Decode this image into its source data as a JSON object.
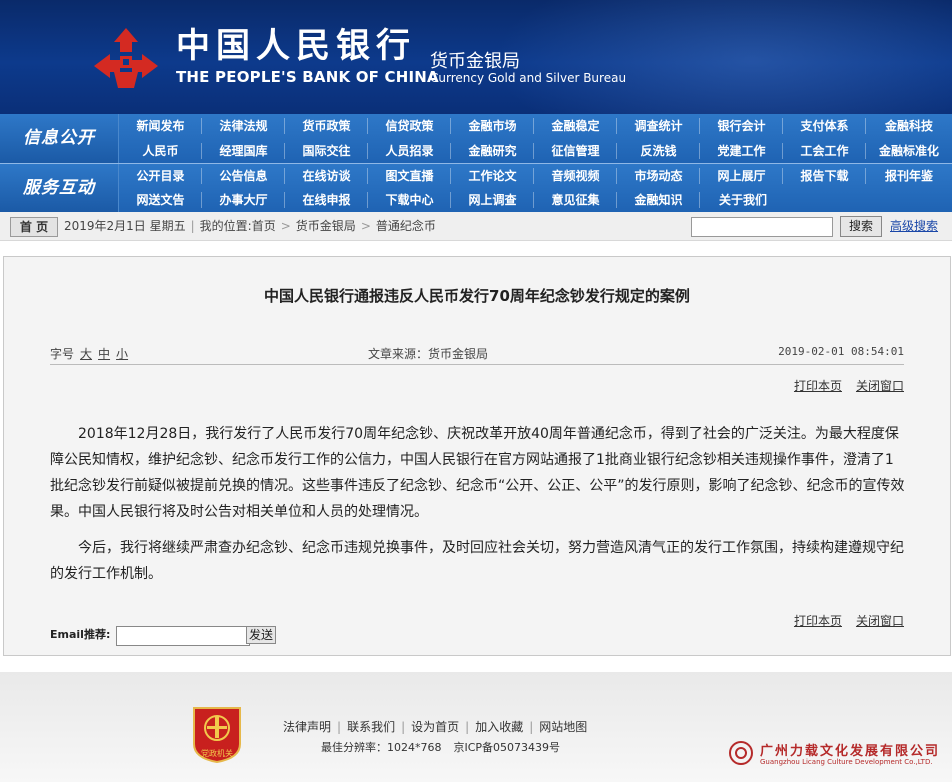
{
  "header": {
    "logo_cn": "中国人民银行",
    "logo_en": "THE PEOPLE'S BANK OF CHINA",
    "bureau_cn": "货币金银局",
    "bureau_en": "Currency  Gold and Silver Bureau",
    "brand_color": "#0d3a8c"
  },
  "nav": {
    "group1_label": "信息公开",
    "group2_label": "服务互动",
    "row1": [
      "新闻发布",
      "法律法规",
      "货币政策",
      "信贷政策",
      "金融市场",
      "金融稳定",
      "调查统计",
      "银行会计",
      "支付体系",
      "金融科技"
    ],
    "row2": [
      "人民币",
      "经理国库",
      "国际交往",
      "人员招录",
      "金融研究",
      "征信管理",
      "反洗钱",
      "党建工作",
      "工会工作",
      "金融标准化"
    ],
    "row3": [
      "公开目录",
      "公告信息",
      "在线访谈",
      "图文直播",
      "工作论文",
      "音频视频",
      "市场动态",
      "网上展厅",
      "报告下载",
      "报刊年鉴"
    ],
    "row4": [
      "网送文告",
      "办事大厅",
      "在线申报",
      "下载中心",
      "网上调查",
      "意见征集",
      "金融知识",
      "关于我们"
    ]
  },
  "crumbbar": {
    "home_label": "首 页",
    "date": "2019年2月1日 星期五",
    "location_label": "我的位置:",
    "crumbs": [
      "首页",
      "货币金银局",
      "普通纪念币"
    ],
    "search_placeholder": "",
    "search_label": "搜索",
    "advanced_search_label": "高级搜索"
  },
  "article": {
    "title": "中国人民银行通报违反人民币发行70周年纪念钞发行规定的案例",
    "font_size_label": "字号",
    "font_sizes": [
      "大",
      "中",
      "小"
    ],
    "source": "文章来源：货币金银局",
    "time": "2019-02-01  08:54:01",
    "print_label": "打印本页",
    "close_label": "关闭窗口",
    "paragraphs": [
      "2018年12月28日，我行发行了人民币发行70周年纪念钞、庆祝改革开放40周年普通纪念币，得到了社会的广泛关注。为最大程度保障公民知情权，维护纪念钞、纪念币发行工作的公信力，中国人民银行在官方网站通报了1批商业银行纪念钞相关违规操作事件，澄清了1批纪念钞发行前疑似被提前兑换的情况。这些事件违反了纪念钞、纪念币“公开、公正、公平”的发行原则，影响了纪念钞、纪念币的宣传效果。中国人民银行将及时公告对相关单位和人员的处理情况。",
      "今后，我行将继续严肃查办纪念钞、纪念币违规兑换事件，及时回应社会关切，努力营造风清气正的发行工作氛围，持续构建遵规守纪的发行工作机制。"
    ],
    "email_label": "Email推荐:",
    "email_value": "",
    "send_label": "发送"
  },
  "footer": {
    "badge_text": "党政机关",
    "links": [
      "法律声明",
      "联系我们",
      "设为首页",
      "加入收藏",
      "网站地图"
    ],
    "resolution": "最佳分辨率：1024*768",
    "icp": "京ICP备05073439号",
    "developer_cn": "广州力载文化发展有限公司",
    "developer_en": "Guangzhou Licang Culture Development Co.,LTD."
  }
}
